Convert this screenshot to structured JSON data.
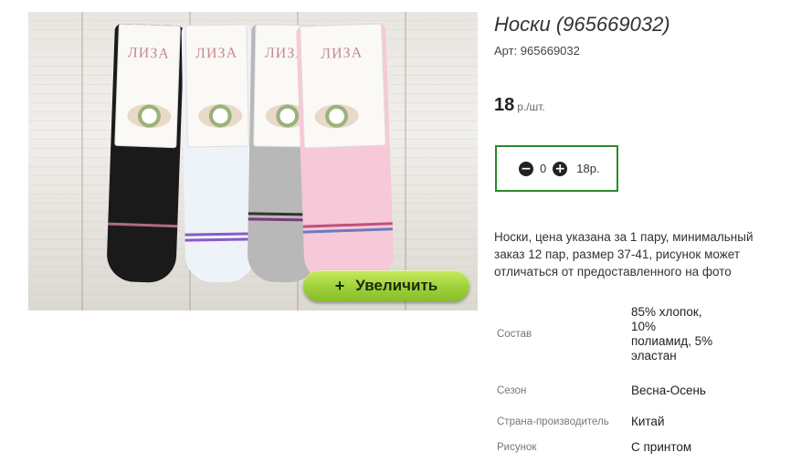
{
  "product": {
    "title": "Носки (965669032)",
    "sku": "Арт: 965669032",
    "price_value": "18",
    "price_unit": "р./шт.",
    "description": "Носки, цена указана за 1 пару, минимальный заказ 12 пар, размер 37-41, рисунок может отличаться от предоставленного на фото"
  },
  "image": {
    "zoom_label": "Увеличить",
    "zoom_plus": "+",
    "tag_brand": "ЛИЗА"
  },
  "quantity": {
    "minus_glyph": "−",
    "plus_glyph": "+",
    "value": "0",
    "sum": "18р.",
    "border_color": "#2a8a2a"
  },
  "specs": [
    {
      "label": "Состав",
      "value": "85% хлопок, 10% полиамид, 5% эластан"
    },
    {
      "label": "Сезон",
      "value": "Весна-Осень"
    },
    {
      "label": "Страна-производитель",
      "value": "Китай"
    },
    {
      "label": "Рисунок",
      "value": "С принтом"
    }
  ],
  "colors": {
    "zoom_button": "#9ed13a",
    "sock_black": "#1a1a1a",
    "sock_white": "#eef3f9",
    "sock_gray": "#b8b8b8",
    "sock_pink": "#f7c8d8"
  }
}
